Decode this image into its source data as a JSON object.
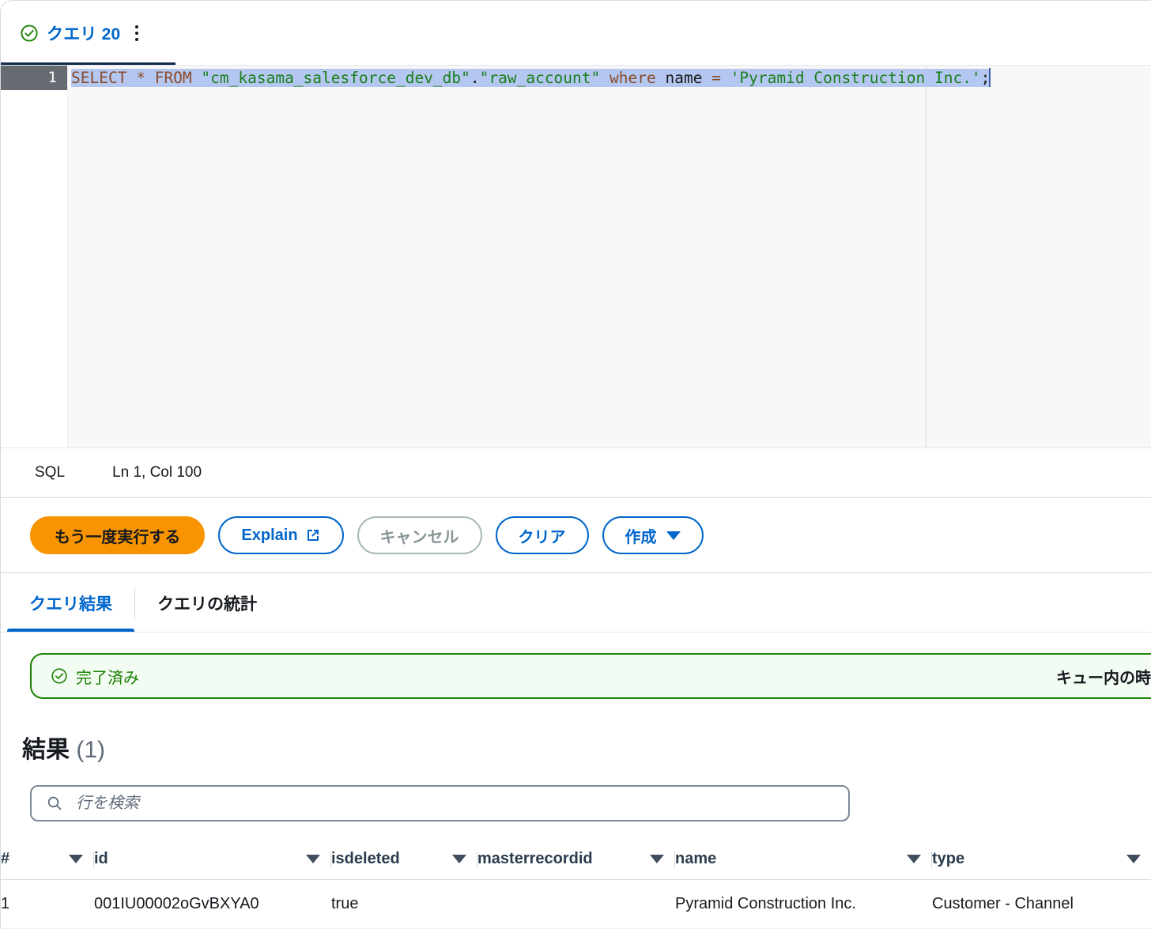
{
  "query_tab": {
    "status_icon": "check-circle-icon",
    "label": "クエリ 20",
    "menu_icon": "kebab-menu-icon"
  },
  "editor": {
    "line_number": "1",
    "language": "SQL",
    "cursor_position": "Ln 1, Col 100",
    "sql_tokens": [
      {
        "t": "SELECT",
        "c": "kw"
      },
      {
        "t": " ",
        "c": "punct"
      },
      {
        "t": "*",
        "c": "op"
      },
      {
        "t": " ",
        "c": "punct"
      },
      {
        "t": "FROM",
        "c": "kw"
      },
      {
        "t": " ",
        "c": "punct"
      },
      {
        "t": "\"cm_kasama_salesforce_dev_db\"",
        "c": "str"
      },
      {
        "t": ".",
        "c": "punct"
      },
      {
        "t": "\"raw_account\"",
        "c": "str"
      },
      {
        "t": " ",
        "c": "punct"
      },
      {
        "t": "where",
        "c": "kw"
      },
      {
        "t": " ",
        "c": "punct"
      },
      {
        "t": "name",
        "c": "id"
      },
      {
        "t": " ",
        "c": "punct"
      },
      {
        "t": "=",
        "c": "op"
      },
      {
        "t": " ",
        "c": "punct"
      },
      {
        "t": "'Pyramid Construction Inc.'",
        "c": "str"
      },
      {
        "t": ";",
        "c": "punct"
      }
    ],
    "sql_plain": "SELECT * FROM \"cm_kasama_salesforce_dev_db\".\"raw_account\" where name = 'Pyramid Construction Inc.';"
  },
  "actions": {
    "run_again": "もう一度実行する",
    "explain": "Explain",
    "explain_icon": "external-link-icon",
    "cancel": "キャンセル",
    "clear": "クリア",
    "create": "作成",
    "create_icon": "chevron-down-icon"
  },
  "result_tabs": [
    {
      "label": "クエリ結果",
      "active": true
    },
    {
      "label": "クエリの統計",
      "active": false
    }
  ],
  "alert": {
    "icon": "check-circle-icon",
    "status": "完了済み",
    "detail": "キュー内の時"
  },
  "results": {
    "title": "結果",
    "count": "(1)",
    "search_placeholder": "行を検索",
    "search_value": "",
    "search_icon": "search-icon",
    "columns": [
      {
        "key": "num",
        "label": "#"
      },
      {
        "key": "id",
        "label": "id"
      },
      {
        "key": "isdeleted",
        "label": "isdeleted"
      },
      {
        "key": "masterrecordid",
        "label": "masterrecordid"
      },
      {
        "key": "name",
        "label": "name"
      },
      {
        "key": "type",
        "label": "type"
      }
    ],
    "rows": [
      {
        "num": "1",
        "id": "001IU00002oGvBXYA0",
        "isdeleted": "true",
        "masterrecordid": "",
        "name": "Pyramid Construction Inc.",
        "type": "Customer - Channel"
      }
    ]
  },
  "colors": {
    "accent_blue": "#0066cc",
    "tab_underline": "#11294b",
    "primary_orange": "#f79400",
    "success_green": "#1d8102",
    "success_bg": "#f2fcf3",
    "selection": "#b4c7f0",
    "string_green": "#1a7f1a",
    "keyword_brown": "#8a4c2c",
    "gutter_active": "#666b72"
  }
}
